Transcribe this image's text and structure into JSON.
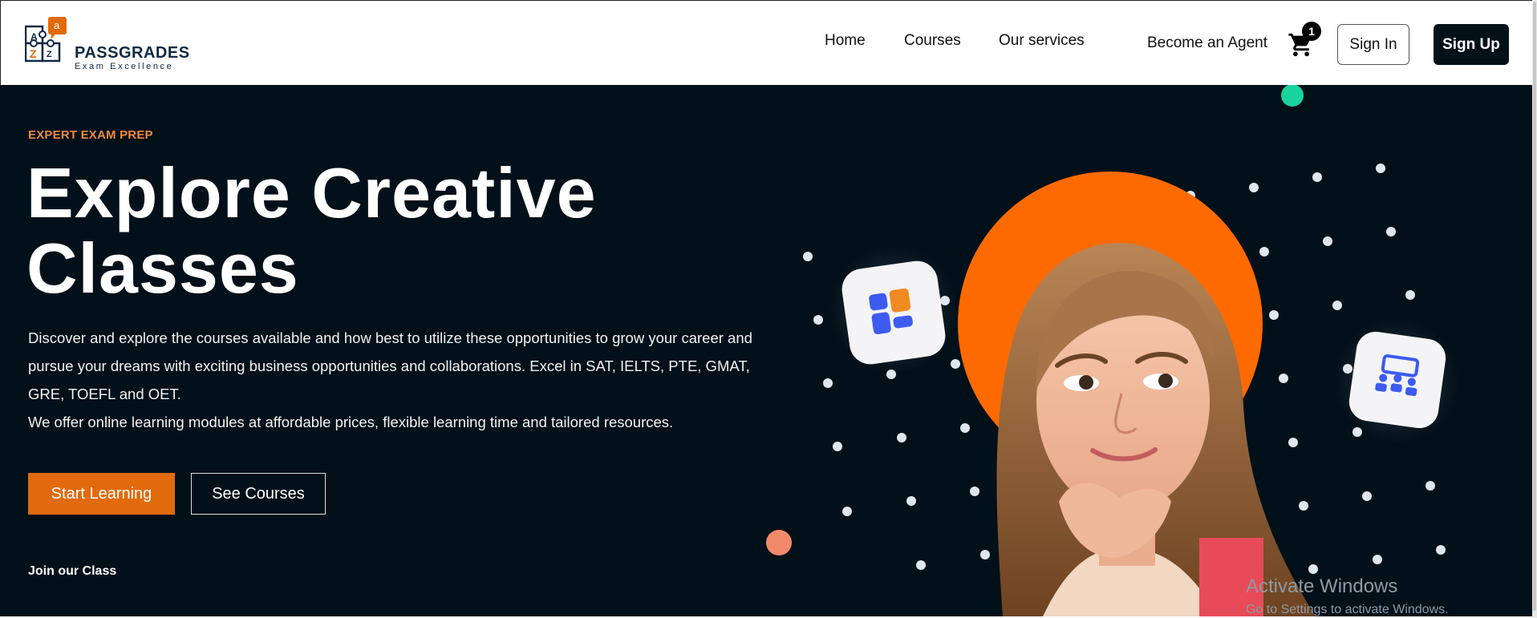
{
  "brand": {
    "name": "PASSGRADES",
    "tagline": "Exam Excellence",
    "logo_letters": [
      "a",
      "A",
      "Z",
      "Z",
      "A"
    ],
    "colors": {
      "navy": "#0f2a44",
      "orange": "#e16a0c"
    }
  },
  "nav": {
    "items": [
      "Home",
      "Courses",
      "Our services"
    ],
    "agent_link": "Become an Agent",
    "cart_count": "1",
    "signin_label": "Sign In",
    "signup_label": "Sign Up"
  },
  "hero": {
    "eyebrow": "EXPERT EXAM PREP",
    "title_line1": "Explore Creative",
    "title_line2": "Classes",
    "description_1": "Discover and explore the courses available and how best to utilize these opportunities to grow your career and pursue your dreams with exciting business opportunities and collaborations. Excel in SAT, IELTS, PTE, GMAT, GRE, TOEFL and OET.",
    "description_2": "We offer online learning modules at affordable prices, flexible learning time and tailored resources.",
    "primary_button": "Start Learning",
    "secondary_button": "See Courses",
    "join_text": "Join our Class",
    "colors": {
      "background": "#02101a",
      "eyebrow": "#ef8a3c",
      "circle": "#ff6a00",
      "teal_dot": "#19d39e",
      "coral_dot": "#f28a6a"
    }
  },
  "watermark": {
    "line1": "Activate Windows",
    "line2": "Go to Settings to activate Windows."
  }
}
